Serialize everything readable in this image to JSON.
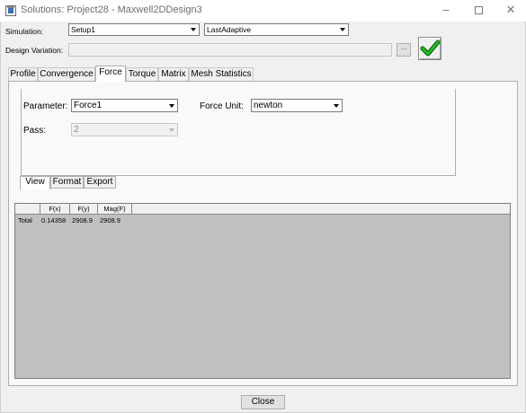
{
  "window": {
    "title": "Solutions: Project28 - Maxwell2DDesign3"
  },
  "simulation": {
    "label": "Simulation:",
    "setup": "Setup1",
    "pass_type": "LastAdaptive"
  },
  "design_variation": {
    "label": "Design Variation:",
    "value": "",
    "browse_label": "..."
  },
  "tabs": [
    {
      "label": "Profile"
    },
    {
      "label": "Convergence"
    },
    {
      "label": "Force"
    },
    {
      "label": "Torque"
    },
    {
      "label": "Matrix"
    },
    {
      "label": "Mesh Statistics"
    }
  ],
  "force": {
    "parameter_label": "Parameter:",
    "parameter_value": "Force1",
    "unit_label": "Force Unit:",
    "unit_value": "newton",
    "pass_label": "Pass:",
    "pass_value": "2"
  },
  "subtabs": [
    {
      "label": "View"
    },
    {
      "label": "Format"
    },
    {
      "label": "Export"
    }
  ],
  "table": {
    "columns": [
      "",
      "F(x)",
      "F(y)",
      "Mag(F)"
    ],
    "rows": [
      [
        "Total",
        "0.14358",
        "2908.9",
        "2908.9"
      ]
    ]
  },
  "footer": {
    "close_label": "Close"
  },
  "colors": {
    "check": "#1aa31a",
    "grid_background": "#c0c0c0"
  }
}
